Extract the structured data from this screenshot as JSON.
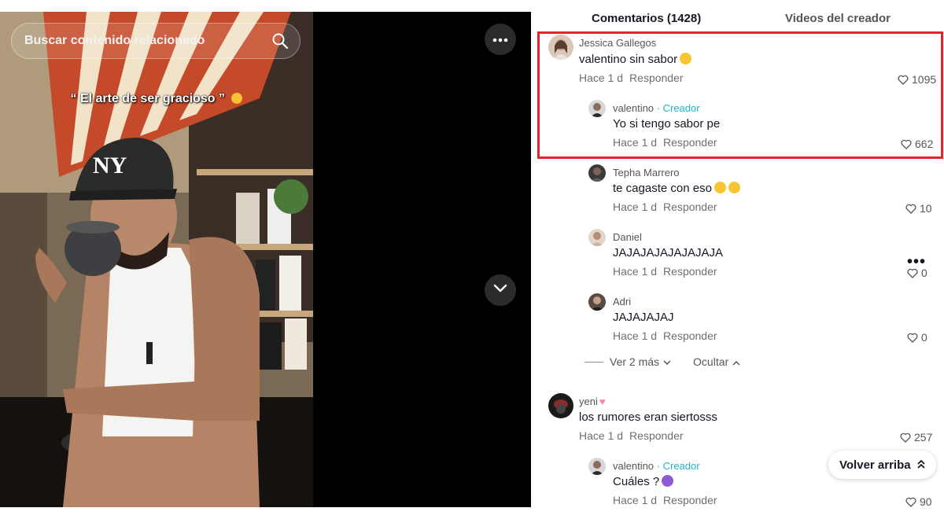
{
  "search": {
    "placeholder": "Buscar contenido relacionado"
  },
  "video": {
    "caption": "“ El arte de ser gracioso ”"
  },
  "tabs": [
    {
      "label": "Comentarios (1428)",
      "active": true
    },
    {
      "label": "Videos del creador",
      "active": false
    }
  ],
  "comments": [
    {
      "user": "Jessica Gallegos",
      "text": "valentino sin sabor",
      "time": "Hace 1 d",
      "reply_label": "Responder",
      "likes": "1095"
    },
    {
      "user": "valentino",
      "creator_tag": "· Creador",
      "text": "Yo si tengo sabor pe",
      "time": "Hace 1 d",
      "reply_label": "Responder",
      "likes": "662"
    },
    {
      "user": "Tepha Marrero",
      "text": "te cagaste con eso",
      "time": "Hace 1 d",
      "reply_label": "Responder",
      "likes": "10"
    },
    {
      "user": "Daniel",
      "text": "JAJAJAJAJAJAJAJA",
      "time": "Hace 1 d",
      "reply_label": "Responder",
      "likes": "0"
    },
    {
      "user": "Adri",
      "text": "JAJAJAJAJ",
      "time": "Hace 1 d",
      "reply_label": "Responder",
      "likes": "0"
    },
    {
      "user": "yeni",
      "text": "los rumores eran siertosss",
      "time": "Hace 1 d",
      "reply_label": "Responder",
      "likes": "257"
    },
    {
      "user": "valentino",
      "creator_tag": "· Creador",
      "text": "Cuáles ?",
      "time": "Hace 1 d",
      "reply_label": "Responder",
      "likes": "90"
    }
  ],
  "replies_control": {
    "show_more": "Ver 2 más",
    "hide": "Ocultar"
  },
  "back_to_top": "Volver arriba",
  "colors": {
    "highlight_border": "#e0262b",
    "creator_tag": "#20b3c8"
  },
  "icons": [
    "search-icon",
    "more-horizontal-icon",
    "chevron-down-icon",
    "heart-outline-icon",
    "chevrons-up-icon",
    "laughing-emoji-icon",
    "smirk-emoji-icon"
  ]
}
